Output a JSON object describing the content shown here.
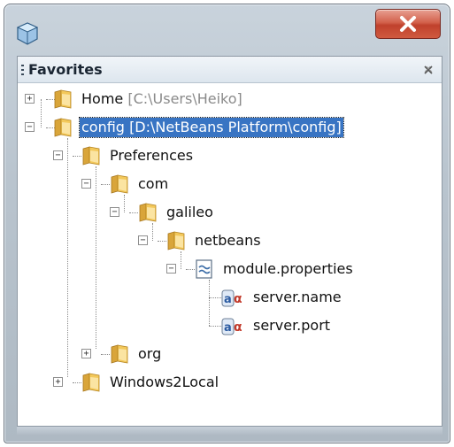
{
  "window": {
    "panel_title": "Favorites"
  },
  "tree": [
    {
      "id": "home",
      "label": "Home",
      "path": "[C:\\Users\\Heiko]",
      "icon": "folder-icon",
      "expanded": false
    },
    {
      "id": "config",
      "label": "config",
      "path": "[D:\\NetBeans Platform\\config]",
      "icon": "folder-icon",
      "expanded": true,
      "selected": true
    },
    {
      "id": "preferences",
      "label": "Preferences",
      "icon": "folder-icon",
      "expanded": true
    },
    {
      "id": "com",
      "label": "com",
      "icon": "folder-icon",
      "expanded": true
    },
    {
      "id": "galileo",
      "label": "galileo",
      "icon": "folder-icon",
      "expanded": true
    },
    {
      "id": "netbeans",
      "label": "netbeans",
      "icon": "folder-icon",
      "expanded": true
    },
    {
      "id": "module-properties",
      "label": "module.properties",
      "icon": "properties-file-icon",
      "expanded": true
    },
    {
      "id": "server-name",
      "label": "server.name",
      "icon": "property-key-icon"
    },
    {
      "id": "server-port",
      "label": "server.port",
      "icon": "property-key-icon"
    },
    {
      "id": "org",
      "label": "org",
      "icon": "folder-icon",
      "expanded": false
    },
    {
      "id": "windows2local",
      "label": "Windows2Local",
      "icon": "folder-icon",
      "expanded": false
    }
  ],
  "colors": {
    "selection": "#3874c3",
    "folder": "#e8b94a",
    "close_button": "#c9472f"
  }
}
